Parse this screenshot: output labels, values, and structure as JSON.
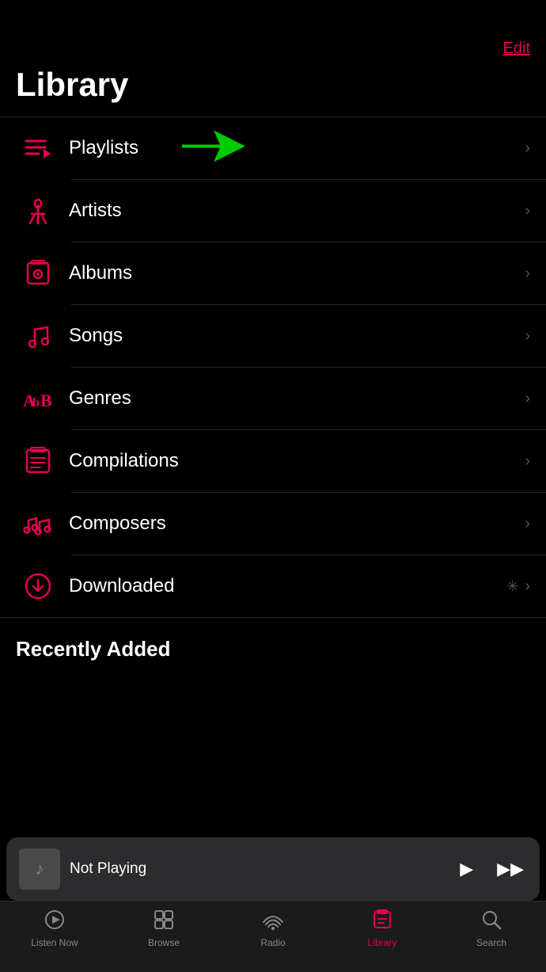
{
  "header": {
    "edit_label": "Edit"
  },
  "page": {
    "title": "Library"
  },
  "list_items": [
    {
      "id": "playlists",
      "label": "Playlists",
      "icon": "playlists-icon",
      "has_arrow": true,
      "has_annotation": true
    },
    {
      "id": "artists",
      "label": "Artists",
      "icon": "artists-icon",
      "has_arrow": true,
      "has_annotation": false
    },
    {
      "id": "albums",
      "label": "Albums",
      "icon": "albums-icon",
      "has_arrow": true,
      "has_annotation": false
    },
    {
      "id": "songs",
      "label": "Songs",
      "icon": "songs-icon",
      "has_arrow": true,
      "has_annotation": false
    },
    {
      "id": "genres",
      "label": "Genres",
      "icon": "genres-icon",
      "has_arrow": true,
      "has_annotation": false
    },
    {
      "id": "compilations",
      "label": "Compilations",
      "icon": "compilations-icon",
      "has_arrow": true,
      "has_annotation": false
    },
    {
      "id": "composers",
      "label": "Composers",
      "icon": "composers-icon",
      "has_arrow": true,
      "has_annotation": false
    },
    {
      "id": "downloaded",
      "label": "Downloaded",
      "icon": "downloaded-icon",
      "has_arrow": true,
      "has_spinner": true,
      "has_annotation": false
    }
  ],
  "recently_added_label": "Recently Added",
  "mini_player": {
    "title": "Not Playing",
    "play_label": "▶",
    "skip_label": "⏭"
  },
  "tab_bar": {
    "items": [
      {
        "id": "listen-now",
        "label": "Listen Now",
        "icon": "listen-now-icon",
        "active": false
      },
      {
        "id": "browse",
        "label": "Browse",
        "icon": "browse-icon",
        "active": false
      },
      {
        "id": "radio",
        "label": "Radio",
        "icon": "radio-icon",
        "active": false
      },
      {
        "id": "library",
        "label": "Library",
        "icon": "library-icon",
        "active": true
      },
      {
        "id": "search",
        "label": "Search",
        "icon": "search-icon",
        "active": false
      }
    ]
  }
}
